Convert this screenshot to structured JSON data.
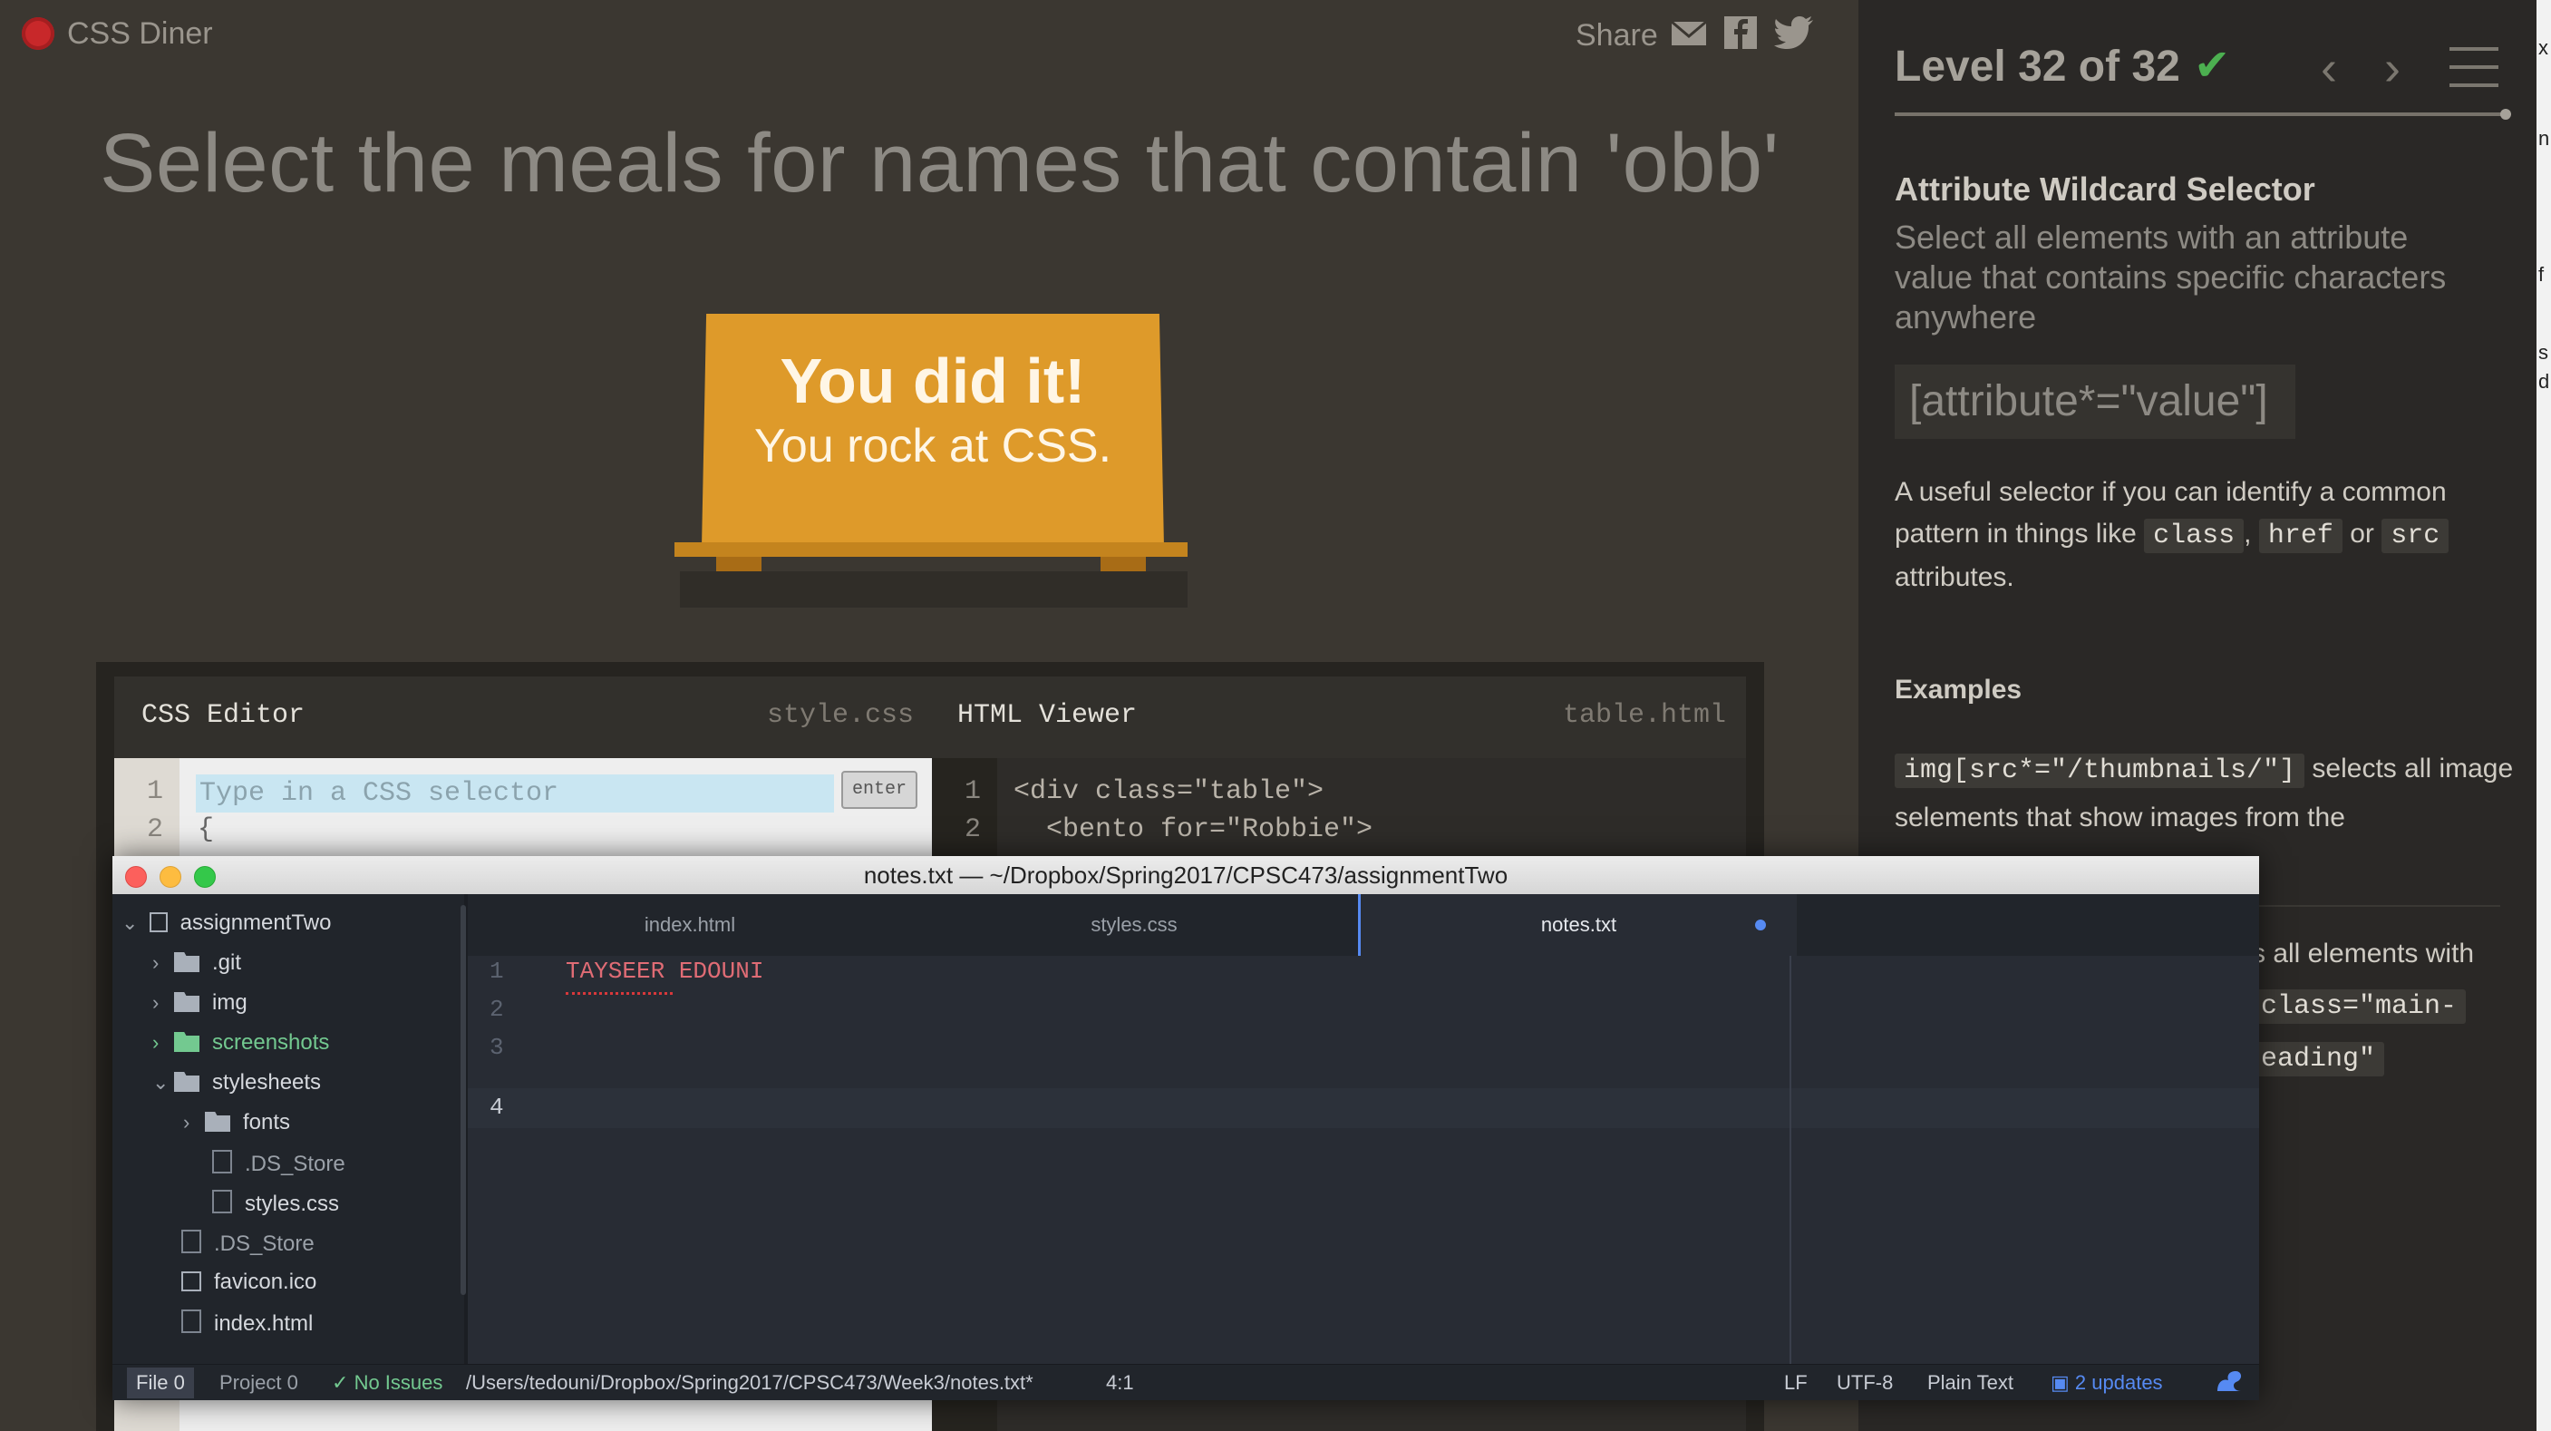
{
  "browser": {
    "logo_text": "CSS Diner",
    "share_label": "Share",
    "headline": "Select the meals for names that contain 'obb'",
    "win_line1": "You did it!",
    "win_line2": "You rock at CSS.",
    "css_editor": {
      "title": "CSS Editor",
      "file": "style.css",
      "line_numbers": [
        "1",
        "2"
      ],
      "placeholder": "Type in a CSS selector",
      "line2": "{",
      "enter_label": "enter"
    },
    "html_viewer": {
      "title": "HTML Viewer",
      "file": "table.html",
      "line_numbers": [
        "1",
        "2"
      ],
      "line1": "<div class=\"table\">",
      "line2": "  <bento for=\"Robbie\">"
    },
    "sidebar": {
      "level": "Level 32 of 32",
      "check": "✔",
      "prev": "‹",
      "next": "›",
      "selector_title": "Attribute Wildcard Selector",
      "selector_desc": "Select all elements with an attribute value that contains specific characters anywhere",
      "syntax": "[attribute*=\"value\"]",
      "help_part1": "A useful selector if you can identify a common pattern in things like ",
      "help_chip1": "class",
      "help_sep1": ", ",
      "help_chip2": "href",
      "help_sep2": " or ",
      "help_chip3": "src",
      "help_part2": " attributes.",
      "examples_title": "Examples",
      "example1_code": "img[src*=\"/thumbnails/\"]",
      "example1_text": " selects all image selements that show images from the",
      "example2_text": "s all elements with",
      "example2_code1": "class=\"main-",
      "example2_code2": "eading\""
    },
    "edge_chars": [
      "x",
      "n",
      "f",
      "s",
      "d"
    ]
  },
  "atom": {
    "title": "notes.txt — ~/Dropbox/Spring2017/CPSC473/assignmentTwo",
    "tree": {
      "root": "assignmentTwo",
      "items": [
        {
          "label": ".git",
          "kind": "folder"
        },
        {
          "label": "img",
          "kind": "folder"
        },
        {
          "label": "screenshots",
          "kind": "folder"
        },
        {
          "label": "stylesheets",
          "kind": "folder"
        },
        {
          "label": "fonts",
          "kind": "folder"
        },
        {
          "label": ".DS_Store",
          "kind": "file"
        },
        {
          "label": "styles.css",
          "kind": "file"
        },
        {
          "label": ".DS_Store",
          "kind": "file"
        },
        {
          "label": "favicon.ico",
          "kind": "image"
        },
        {
          "label": "index.html",
          "kind": "file"
        }
      ]
    },
    "tabs": [
      {
        "label": "index.html"
      },
      {
        "label": "styles.css"
      },
      {
        "label": "notes.txt"
      }
    ],
    "line_numbers": [
      "1",
      "2",
      "3",
      "4"
    ],
    "code_line1": "TAYSEER EDOUNI",
    "status": {
      "file_label": "File",
      "file_count": "0",
      "project_label": "Project",
      "project_count": "0",
      "no_issues": "No Issues",
      "path": "/Users/tedouni/Dropbox/Spring2017/CPSC473/Week3/notes.txt*",
      "cursor": "4:1",
      "line_ending": "LF",
      "encoding": "UTF-8",
      "grammar": "Plain Text",
      "updates": "2 updates"
    }
  },
  "colors": {
    "table": "#de9a2a",
    "accent_blue": "#568af2",
    "success_green": "#4caf50"
  }
}
